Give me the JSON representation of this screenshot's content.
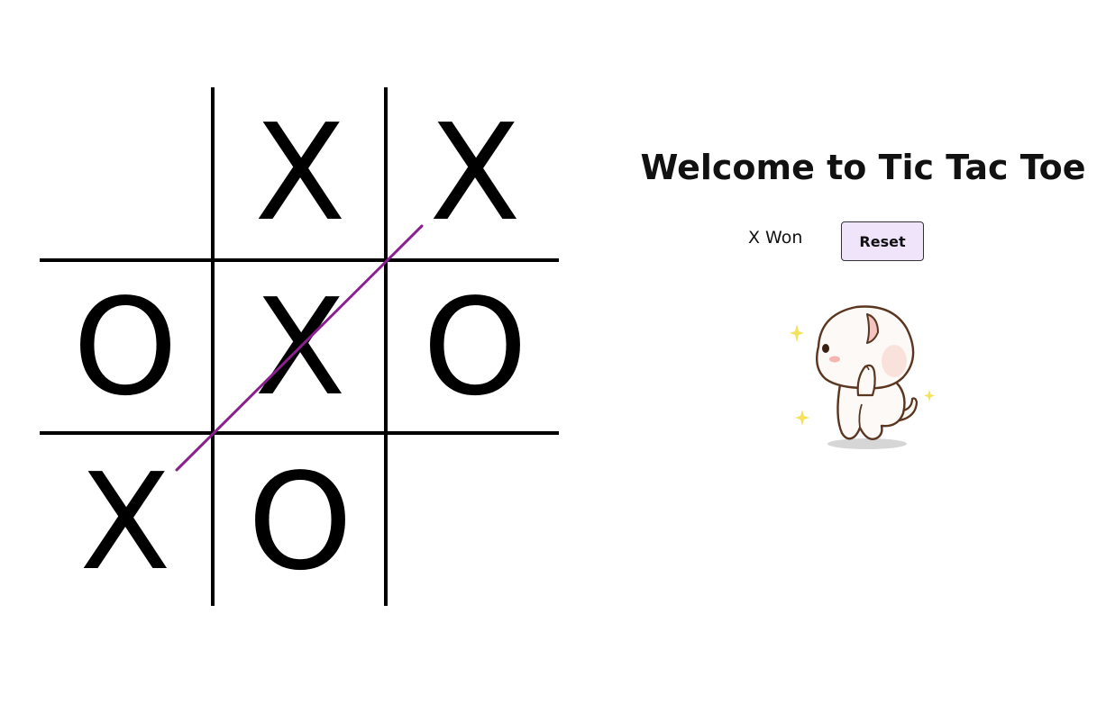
{
  "title": "Welcome to Tic Tac Toe",
  "status": "X Won",
  "reset_label": "Reset",
  "board": {
    "cells": [
      "",
      "X",
      "X",
      "O",
      "X",
      "O",
      "X",
      "O",
      ""
    ],
    "winning_line": [
      2,
      4,
      6
    ]
  },
  "colors": {
    "win_line": "#8b1f8f",
    "button_bg": "#f0e4fb"
  },
  "mascot_icon": "cute-cat-sticker-icon"
}
